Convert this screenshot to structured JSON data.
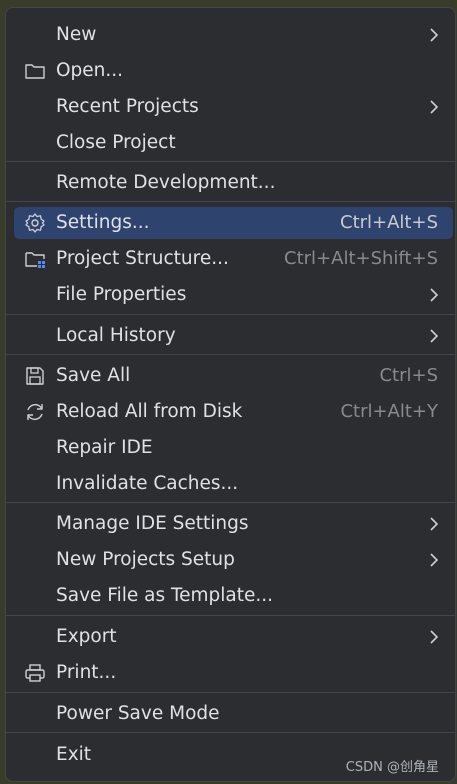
{
  "menu": {
    "items": [
      {
        "label": "New",
        "shortcut": "",
        "submenu": true,
        "icon": ""
      },
      {
        "label": "Open...",
        "shortcut": "",
        "submenu": false,
        "icon": "folder-icon"
      },
      {
        "label": "Recent Projects",
        "shortcut": "",
        "submenu": true,
        "icon": ""
      },
      {
        "label": "Close Project",
        "shortcut": "",
        "submenu": false,
        "icon": ""
      },
      {
        "label": "Remote Development...",
        "shortcut": "",
        "submenu": false,
        "icon": ""
      },
      {
        "label": "Settings...",
        "shortcut": "Ctrl+Alt+S",
        "submenu": false,
        "icon": "gear-icon",
        "selected": true
      },
      {
        "label": "Project Structure...",
        "shortcut": "Ctrl+Alt+Shift+S",
        "submenu": false,
        "icon": "project-structure-icon"
      },
      {
        "label": "File Properties",
        "shortcut": "",
        "submenu": true,
        "icon": ""
      },
      {
        "label": "Local History",
        "shortcut": "",
        "submenu": true,
        "icon": ""
      },
      {
        "label": "Save All",
        "shortcut": "Ctrl+S",
        "submenu": false,
        "icon": "save-icon"
      },
      {
        "label": "Reload All from Disk",
        "shortcut": "Ctrl+Alt+Y",
        "submenu": false,
        "icon": "reload-icon"
      },
      {
        "label": "Repair IDE",
        "shortcut": "",
        "submenu": false,
        "icon": ""
      },
      {
        "label": "Invalidate Caches...",
        "shortcut": "",
        "submenu": false,
        "icon": ""
      },
      {
        "label": "Manage IDE Settings",
        "shortcut": "",
        "submenu": true,
        "icon": ""
      },
      {
        "label": "New Projects Setup",
        "shortcut": "",
        "submenu": true,
        "icon": ""
      },
      {
        "label": "Save File as Template...",
        "shortcut": "",
        "submenu": false,
        "icon": ""
      },
      {
        "label": "Export",
        "shortcut": "",
        "submenu": true,
        "icon": ""
      },
      {
        "label": "Print...",
        "shortcut": "",
        "submenu": false,
        "icon": "printer-icon"
      },
      {
        "label": "Power Save Mode",
        "shortcut": "",
        "submenu": false,
        "icon": ""
      },
      {
        "label": "Exit",
        "shortcut": "",
        "submenu": false,
        "icon": ""
      }
    ]
  },
  "watermark": "CSDN @创角星",
  "colors": {
    "background": "#2b2d30",
    "selection": "#2e436e",
    "text": "#dfe1e5",
    "shortcut": "#868a91",
    "separator": "#43454a"
  }
}
